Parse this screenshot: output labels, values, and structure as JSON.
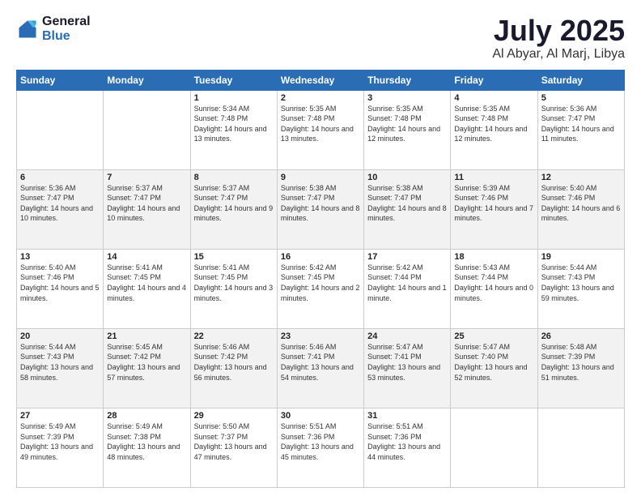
{
  "logo": {
    "general": "General",
    "blue": "Blue"
  },
  "title": "July 2025",
  "subtitle": "Al Abyar, Al Marj, Libya",
  "headers": [
    "Sunday",
    "Monday",
    "Tuesday",
    "Wednesday",
    "Thursday",
    "Friday",
    "Saturday"
  ],
  "weeks": [
    [
      {
        "day": "",
        "info": ""
      },
      {
        "day": "",
        "info": ""
      },
      {
        "day": "1",
        "info": "Sunrise: 5:34 AM\nSunset: 7:48 PM\nDaylight: 14 hours and 13 minutes."
      },
      {
        "day": "2",
        "info": "Sunrise: 5:35 AM\nSunset: 7:48 PM\nDaylight: 14 hours and 13 minutes."
      },
      {
        "day": "3",
        "info": "Sunrise: 5:35 AM\nSunset: 7:48 PM\nDaylight: 14 hours and 12 minutes."
      },
      {
        "day": "4",
        "info": "Sunrise: 5:35 AM\nSunset: 7:48 PM\nDaylight: 14 hours and 12 minutes."
      },
      {
        "day": "5",
        "info": "Sunrise: 5:36 AM\nSunset: 7:47 PM\nDaylight: 14 hours and 11 minutes."
      }
    ],
    [
      {
        "day": "6",
        "info": "Sunrise: 5:36 AM\nSunset: 7:47 PM\nDaylight: 14 hours and 10 minutes."
      },
      {
        "day": "7",
        "info": "Sunrise: 5:37 AM\nSunset: 7:47 PM\nDaylight: 14 hours and 10 minutes."
      },
      {
        "day": "8",
        "info": "Sunrise: 5:37 AM\nSunset: 7:47 PM\nDaylight: 14 hours and 9 minutes."
      },
      {
        "day": "9",
        "info": "Sunrise: 5:38 AM\nSunset: 7:47 PM\nDaylight: 14 hours and 8 minutes."
      },
      {
        "day": "10",
        "info": "Sunrise: 5:38 AM\nSunset: 7:47 PM\nDaylight: 14 hours and 8 minutes."
      },
      {
        "day": "11",
        "info": "Sunrise: 5:39 AM\nSunset: 7:46 PM\nDaylight: 14 hours and 7 minutes."
      },
      {
        "day": "12",
        "info": "Sunrise: 5:40 AM\nSunset: 7:46 PM\nDaylight: 14 hours and 6 minutes."
      }
    ],
    [
      {
        "day": "13",
        "info": "Sunrise: 5:40 AM\nSunset: 7:46 PM\nDaylight: 14 hours and 5 minutes."
      },
      {
        "day": "14",
        "info": "Sunrise: 5:41 AM\nSunset: 7:45 PM\nDaylight: 14 hours and 4 minutes."
      },
      {
        "day": "15",
        "info": "Sunrise: 5:41 AM\nSunset: 7:45 PM\nDaylight: 14 hours and 3 minutes."
      },
      {
        "day": "16",
        "info": "Sunrise: 5:42 AM\nSunset: 7:45 PM\nDaylight: 14 hours and 2 minutes."
      },
      {
        "day": "17",
        "info": "Sunrise: 5:42 AM\nSunset: 7:44 PM\nDaylight: 14 hours and 1 minute."
      },
      {
        "day": "18",
        "info": "Sunrise: 5:43 AM\nSunset: 7:44 PM\nDaylight: 14 hours and 0 minutes."
      },
      {
        "day": "19",
        "info": "Sunrise: 5:44 AM\nSunset: 7:43 PM\nDaylight: 13 hours and 59 minutes."
      }
    ],
    [
      {
        "day": "20",
        "info": "Sunrise: 5:44 AM\nSunset: 7:43 PM\nDaylight: 13 hours and 58 minutes."
      },
      {
        "day": "21",
        "info": "Sunrise: 5:45 AM\nSunset: 7:42 PM\nDaylight: 13 hours and 57 minutes."
      },
      {
        "day": "22",
        "info": "Sunrise: 5:46 AM\nSunset: 7:42 PM\nDaylight: 13 hours and 56 minutes."
      },
      {
        "day": "23",
        "info": "Sunrise: 5:46 AM\nSunset: 7:41 PM\nDaylight: 13 hours and 54 minutes."
      },
      {
        "day": "24",
        "info": "Sunrise: 5:47 AM\nSunset: 7:41 PM\nDaylight: 13 hours and 53 minutes."
      },
      {
        "day": "25",
        "info": "Sunrise: 5:47 AM\nSunset: 7:40 PM\nDaylight: 13 hours and 52 minutes."
      },
      {
        "day": "26",
        "info": "Sunrise: 5:48 AM\nSunset: 7:39 PM\nDaylight: 13 hours and 51 minutes."
      }
    ],
    [
      {
        "day": "27",
        "info": "Sunrise: 5:49 AM\nSunset: 7:39 PM\nDaylight: 13 hours and 49 minutes."
      },
      {
        "day": "28",
        "info": "Sunrise: 5:49 AM\nSunset: 7:38 PM\nDaylight: 13 hours and 48 minutes."
      },
      {
        "day": "29",
        "info": "Sunrise: 5:50 AM\nSunset: 7:37 PM\nDaylight: 13 hours and 47 minutes."
      },
      {
        "day": "30",
        "info": "Sunrise: 5:51 AM\nSunset: 7:36 PM\nDaylight: 13 hours and 45 minutes."
      },
      {
        "day": "31",
        "info": "Sunrise: 5:51 AM\nSunset: 7:36 PM\nDaylight: 13 hours and 44 minutes."
      },
      {
        "day": "",
        "info": ""
      },
      {
        "day": "",
        "info": ""
      }
    ]
  ]
}
